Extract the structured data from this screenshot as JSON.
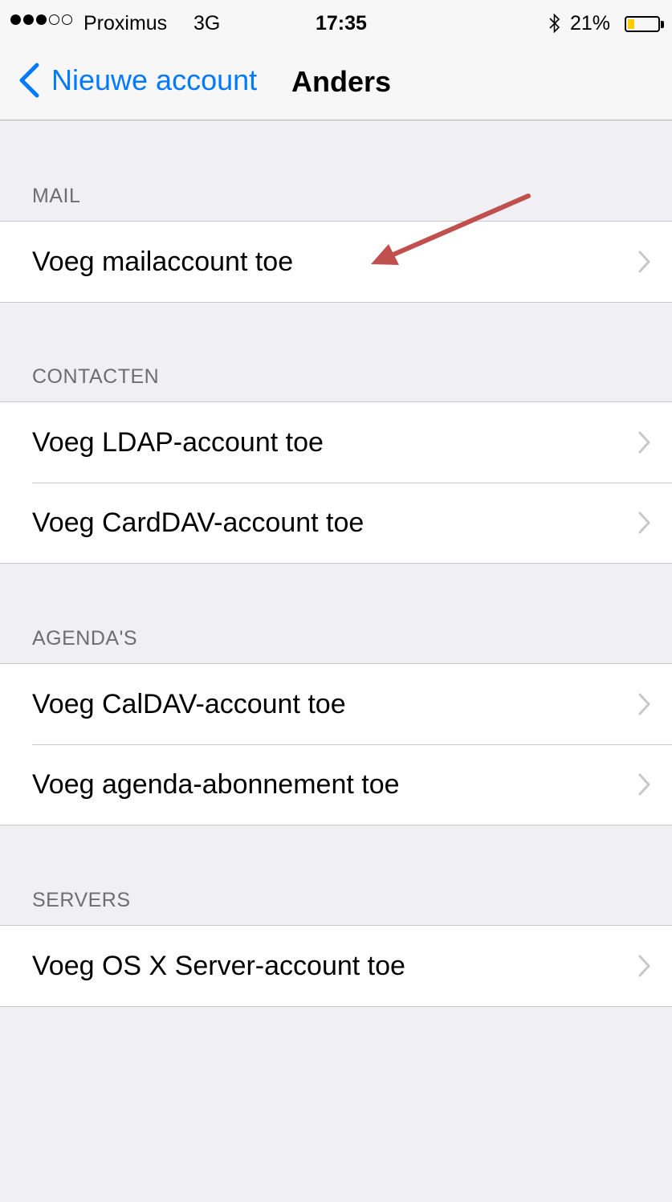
{
  "status_bar": {
    "carrier": "Proximus",
    "network": "3G",
    "time": "17:35",
    "battery_percent": "21%",
    "battery_level": 0.21,
    "signal_bars_filled": 3,
    "signal_bars_total": 5,
    "battery_color": "#ffcc00"
  },
  "nav": {
    "back_label": "Nieuwe account",
    "title": "Anders",
    "accent_color": "#007aff"
  },
  "sections": [
    {
      "header": "MAIL",
      "rows": [
        {
          "label": "Voeg mailaccount toe"
        }
      ]
    },
    {
      "header": "CONTACTEN",
      "rows": [
        {
          "label": "Voeg LDAP-account toe"
        },
        {
          "label": "Voeg CardDAV-account toe"
        }
      ]
    },
    {
      "header": "AGENDA'S",
      "rows": [
        {
          "label": "Voeg CalDAV-account toe"
        },
        {
          "label": "Voeg agenda-abonnement toe"
        }
      ]
    },
    {
      "header": "SERVERS",
      "rows": [
        {
          "label": "Voeg OS X Server-account toe"
        }
      ]
    }
  ],
  "annotation": {
    "icon": "red-arrow-icon",
    "color": "#c0504d"
  }
}
